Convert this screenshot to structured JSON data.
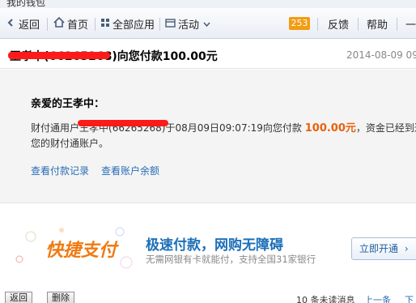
{
  "window": {
    "title": "我的钱包"
  },
  "toolbar": {
    "back": "返回",
    "home": "首页",
    "all_apps": "全部应用",
    "activity": "活动",
    "unread_count": "253",
    "feedback": "反馈",
    "help": "帮助",
    "more": "一"
  },
  "subject": {
    "prefix": "王孝中",
    "account_open": "(",
    "account_masked": "66265268",
    "text": ")向您付款100.00元",
    "date": "2014-08-09 09"
  },
  "message": {
    "greeting": "亲爱的王孝中：",
    "line1_prefix": "财付通用户",
    "line1_mid": "王孝中(66265268)于08月09日09:07:19向您付款",
    "amount": "100.00元",
    "line1_suffix": "，资金已经到达",
    "line2": "您的财付通账户。",
    "link_payments": "查看付款记录",
    "link_balance": "查看账户余额"
  },
  "ad": {
    "logo_text": "快捷支付",
    "headline": "极速付款，网购无障碍",
    "subline": "无需网银有卡就能付，支持全国31家银行",
    "cta": "立即开通"
  },
  "footer": {
    "back": "返回",
    "delete": "删除",
    "unread": "10 条未读消息",
    "prev": "上一条",
    "next": "下"
  },
  "colors": {
    "accent_orange": "#e8620b",
    "link_blue": "#2a6db5",
    "badge_orange": "#f39c12",
    "redaction": "#ff1a1a"
  }
}
